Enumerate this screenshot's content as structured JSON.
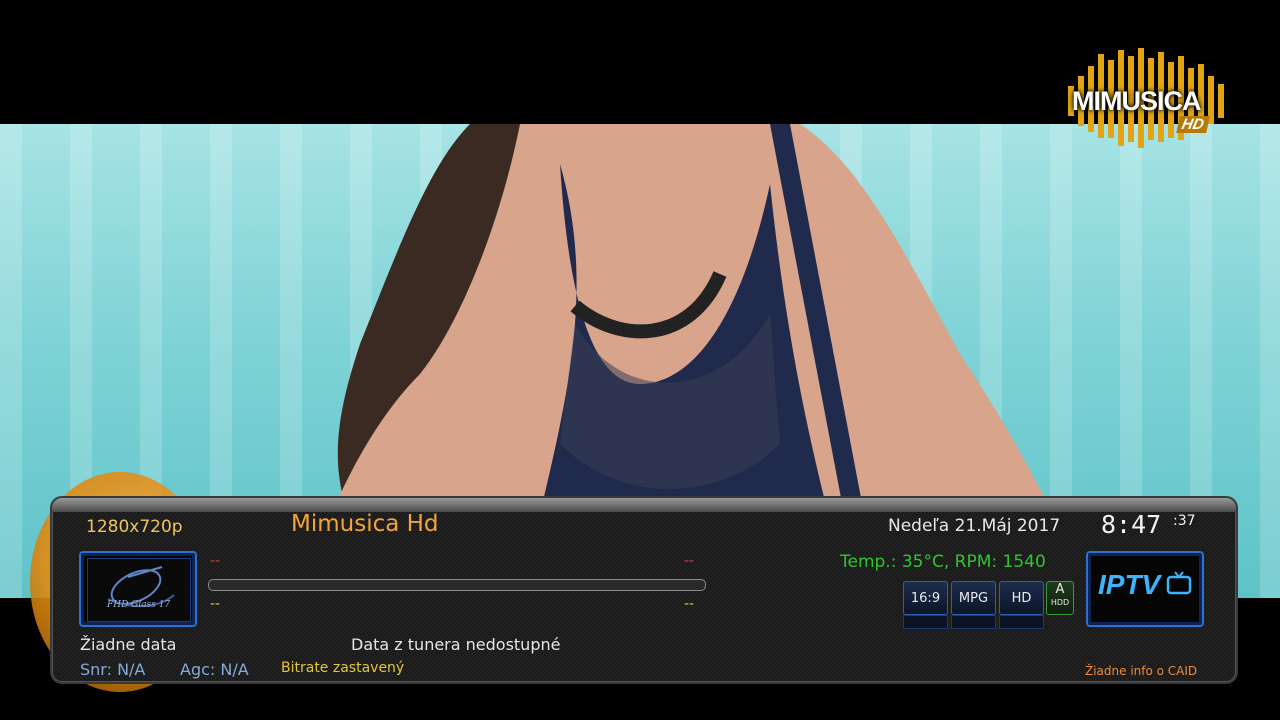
{
  "overlay_logo": {
    "text": "MIMUSICA",
    "badge": "HD"
  },
  "infobar": {
    "resolution": "1280x720p",
    "channel_name": "Mimusica Hd",
    "date": "Nedeľa  21.Máj 2017",
    "clock": "8:47",
    "clock_seconds": ":37",
    "temperature": "Temp.: 35°C, RPM: 1540",
    "picon_label": "FHD Glass 17",
    "event_now_time": "--",
    "event_now_remaining": "--",
    "event_next_time": "--",
    "event_next_remaining": "--",
    "progress": 0,
    "badges": [
      "16:9",
      "MPG",
      "HD"
    ],
    "badge_a_top": "A",
    "badge_a_bottom": "HDD",
    "iptv_label": "IPTV",
    "no_data": "Žiadne data",
    "tuner_status": "Data z tunera nedostupné",
    "snr": "Snr: N/A",
    "agc": "Agc: N/A",
    "bitrate": "Bitrate zastavený",
    "caid": "Žiadne info o CAID"
  },
  "colors": {
    "accent_orange": "#f4a43c",
    "accent_green": "#2fc52f",
    "accent_blue": "#2e6fd0"
  }
}
